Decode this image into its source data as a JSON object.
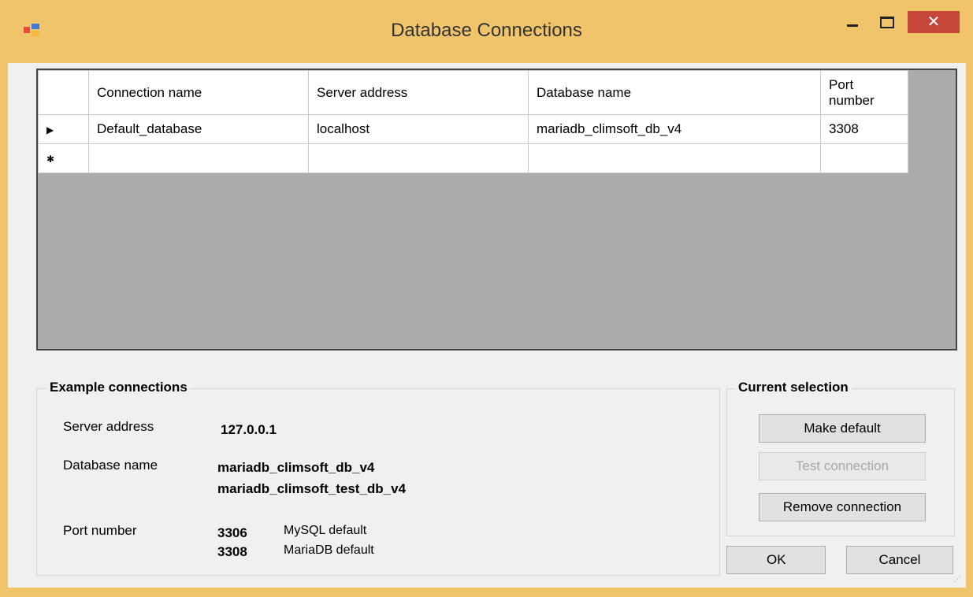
{
  "window": {
    "title": "Database Connections",
    "close_glyph": "✕"
  },
  "grid": {
    "columns": [
      "Connection name",
      "Server address",
      "Database name",
      "Port\nnumber"
    ],
    "rows": [
      {
        "indicator": "▶",
        "cells": [
          "Default_database",
          "localhost",
          "mariadb_climsoft_db_v4",
          "3308"
        ]
      },
      {
        "indicator": "✱",
        "cells": [
          "",
          "",
          "",
          ""
        ]
      }
    ]
  },
  "examples": {
    "title": "Example connections",
    "server_label": "Server address",
    "server_value": "127.0.0.1",
    "database_label": "Database name",
    "database_values": [
      "mariadb_climsoft_db_v4",
      "mariadb_climsoft_test_db_v4"
    ],
    "port_label": "Port number",
    "ports": [
      {
        "number": "3306",
        "desc": "MySQL default"
      },
      {
        "number": "3308",
        "desc": "MariaDB default"
      }
    ]
  },
  "current_selection": {
    "title": "Current selection",
    "make_default": "Make default",
    "test_connection": "Test connection",
    "remove_connection": "Remove connection"
  },
  "dialog": {
    "ok": "OK",
    "cancel": "Cancel"
  },
  "colors": {
    "title_bar": "#f0c46a",
    "close_button": "#c7463a",
    "grid_background": "#ababab"
  }
}
